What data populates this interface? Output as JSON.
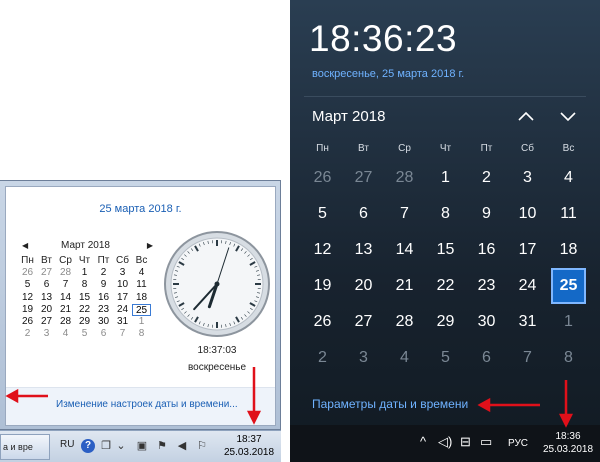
{
  "win7": {
    "header_date": "25 марта 2018 г.",
    "calendar": {
      "month_title": "Март 2018",
      "prev_glyph": "◀",
      "next_glyph": "▶",
      "weekdays": [
        "Пн",
        "Вт",
        "Ср",
        "Чт",
        "Пт",
        "Сб",
        "Вс"
      ],
      "days": [
        {
          "d": "26",
          "dim": true
        },
        {
          "d": "27",
          "dim": true
        },
        {
          "d": "28",
          "dim": true
        },
        {
          "d": "1"
        },
        {
          "d": "2"
        },
        {
          "d": "3"
        },
        {
          "d": "4"
        },
        {
          "d": "5"
        },
        {
          "d": "6"
        },
        {
          "d": "7"
        },
        {
          "d": "8"
        },
        {
          "d": "9"
        },
        {
          "d": "10"
        },
        {
          "d": "11"
        },
        {
          "d": "12"
        },
        {
          "d": "13"
        },
        {
          "d": "14"
        },
        {
          "d": "15"
        },
        {
          "d": "16"
        },
        {
          "d": "17"
        },
        {
          "d": "18"
        },
        {
          "d": "19"
        },
        {
          "d": "20"
        },
        {
          "d": "21"
        },
        {
          "d": "22"
        },
        {
          "d": "23"
        },
        {
          "d": "24"
        },
        {
          "d": "25",
          "today": true
        },
        {
          "d": "26"
        },
        {
          "d": "27"
        },
        {
          "d": "28"
        },
        {
          "d": "29"
        },
        {
          "d": "30"
        },
        {
          "d": "31"
        },
        {
          "d": "1",
          "dim": true
        },
        {
          "d": "2",
          "dim": true
        },
        {
          "d": "3",
          "dim": true
        },
        {
          "d": "4",
          "dim": true
        },
        {
          "d": "5",
          "dim": true
        },
        {
          "d": "6",
          "dim": true
        },
        {
          "d": "7",
          "dim": true
        },
        {
          "d": "8",
          "dim": true
        }
      ]
    },
    "clock_time": "18:37:03",
    "clock_hands": {
      "hour": 18,
      "minute": 37,
      "second": 3
    },
    "weekday_text": "воскресенье",
    "settings_link": "Изменение настроек даты и времени...",
    "taskbar": {
      "task_label": "а и вре",
      "lang": "RU",
      "time": "18:37",
      "date": "25.03.2018"
    }
  },
  "win10": {
    "time": "18:36:23",
    "date_link": "воскресенье, 25 марта 2018 г.",
    "month_title": "Март 2018",
    "weekdays": [
      "Пн",
      "Вт",
      "Ср",
      "Чт",
      "Пт",
      "Сб",
      "Вс"
    ],
    "days": [
      {
        "d": "26",
        "dim": true
      },
      {
        "d": "27",
        "dim": true
      },
      {
        "d": "28",
        "dim": true
      },
      {
        "d": "1"
      },
      {
        "d": "2"
      },
      {
        "d": "3"
      },
      {
        "d": "4"
      },
      {
        "d": "5"
      },
      {
        "d": "6"
      },
      {
        "d": "7"
      },
      {
        "d": "8"
      },
      {
        "d": "9"
      },
      {
        "d": "10"
      },
      {
        "d": "11"
      },
      {
        "d": "12"
      },
      {
        "d": "13"
      },
      {
        "d": "14"
      },
      {
        "d": "15"
      },
      {
        "d": "16"
      },
      {
        "d": "17"
      },
      {
        "d": "18"
      },
      {
        "d": "19"
      },
      {
        "d": "20"
      },
      {
        "d": "21"
      },
      {
        "d": "22"
      },
      {
        "d": "23"
      },
      {
        "d": "24"
      },
      {
        "d": "25",
        "today": true
      },
      {
        "d": "26"
      },
      {
        "d": "27"
      },
      {
        "d": "28"
      },
      {
        "d": "29"
      },
      {
        "d": "30"
      },
      {
        "d": "31"
      },
      {
        "d": "1",
        "dim": true
      },
      {
        "d": "2",
        "dim": true
      },
      {
        "d": "3",
        "dim": true
      },
      {
        "d": "4",
        "dim": true
      },
      {
        "d": "5",
        "dim": true
      },
      {
        "d": "6",
        "dim": true
      },
      {
        "d": "7",
        "dim": true
      },
      {
        "d": "8",
        "dim": true
      }
    ],
    "settings_link": "Параметры даты и времени",
    "taskbar": {
      "lang": "РУС",
      "time": "18:36",
      "date": "25.03.2018"
    }
  },
  "colors": {
    "annotation_red": "#e0101a",
    "w7_link_blue": "#1a5fb4",
    "w10_accent": "#1469c7",
    "w10_link": "#6fb2ff"
  }
}
